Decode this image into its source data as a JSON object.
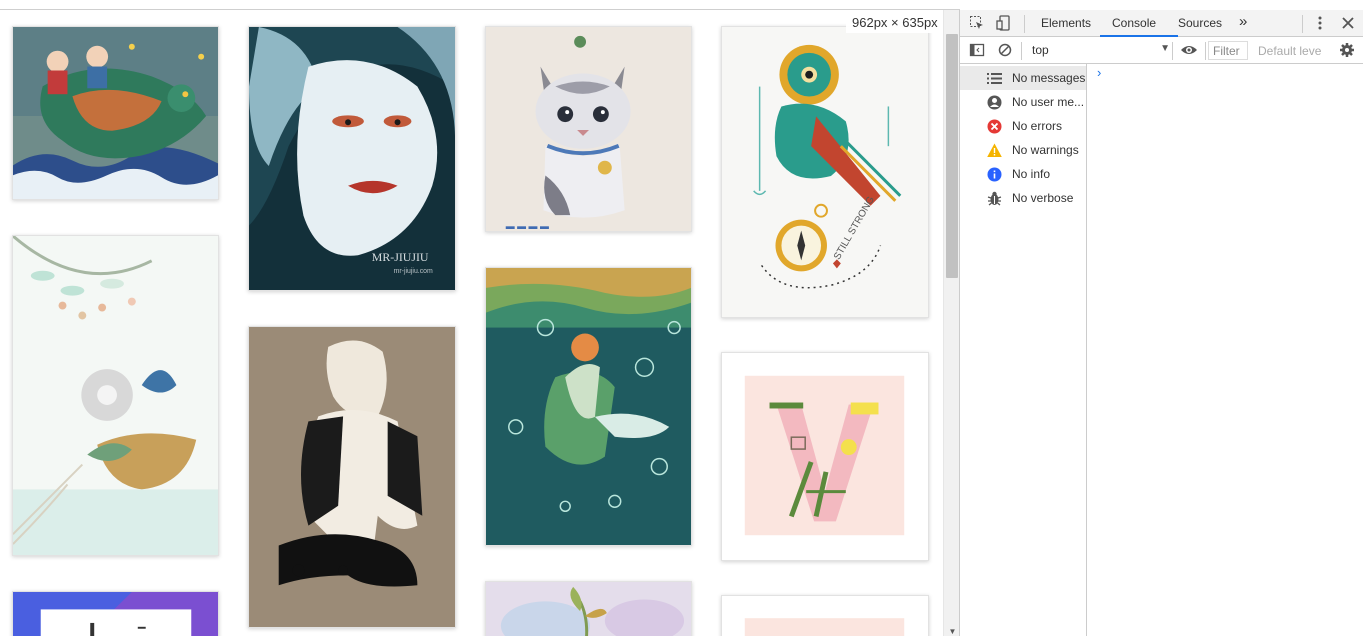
{
  "viewport": {
    "width_text": "962px",
    "times": "×",
    "height_text": "635px"
  },
  "devtools": {
    "tabs": [
      {
        "label": "Elements"
      },
      {
        "label": "Console"
      },
      {
        "label": "Sources"
      }
    ],
    "more_tabs": "»",
    "context": "top",
    "filter_placeholder": "Filter",
    "levels": "Default leve",
    "sidebar": [
      {
        "label": "No messages",
        "icon": "list-icon"
      },
      {
        "label": "No user me...",
        "icon": "user-icon"
      },
      {
        "label": "No errors",
        "icon": "error-icon"
      },
      {
        "label": "No warnings",
        "icon": "warning-icon"
      },
      {
        "label": "No info",
        "icon": "info-icon"
      },
      {
        "label": "No verbose",
        "icon": "bug-icon"
      }
    ],
    "prompt": "›"
  },
  "gallery": {
    "watermark_title": "MR-JIUJIU",
    "watermark_url": "mr-jiujiu.com",
    "still_strong": "STILL STRONG"
  },
  "colors": {
    "accent": "#1a73e8",
    "error": "#e53935",
    "warning": "#f5b400",
    "info": "#2962ff"
  }
}
